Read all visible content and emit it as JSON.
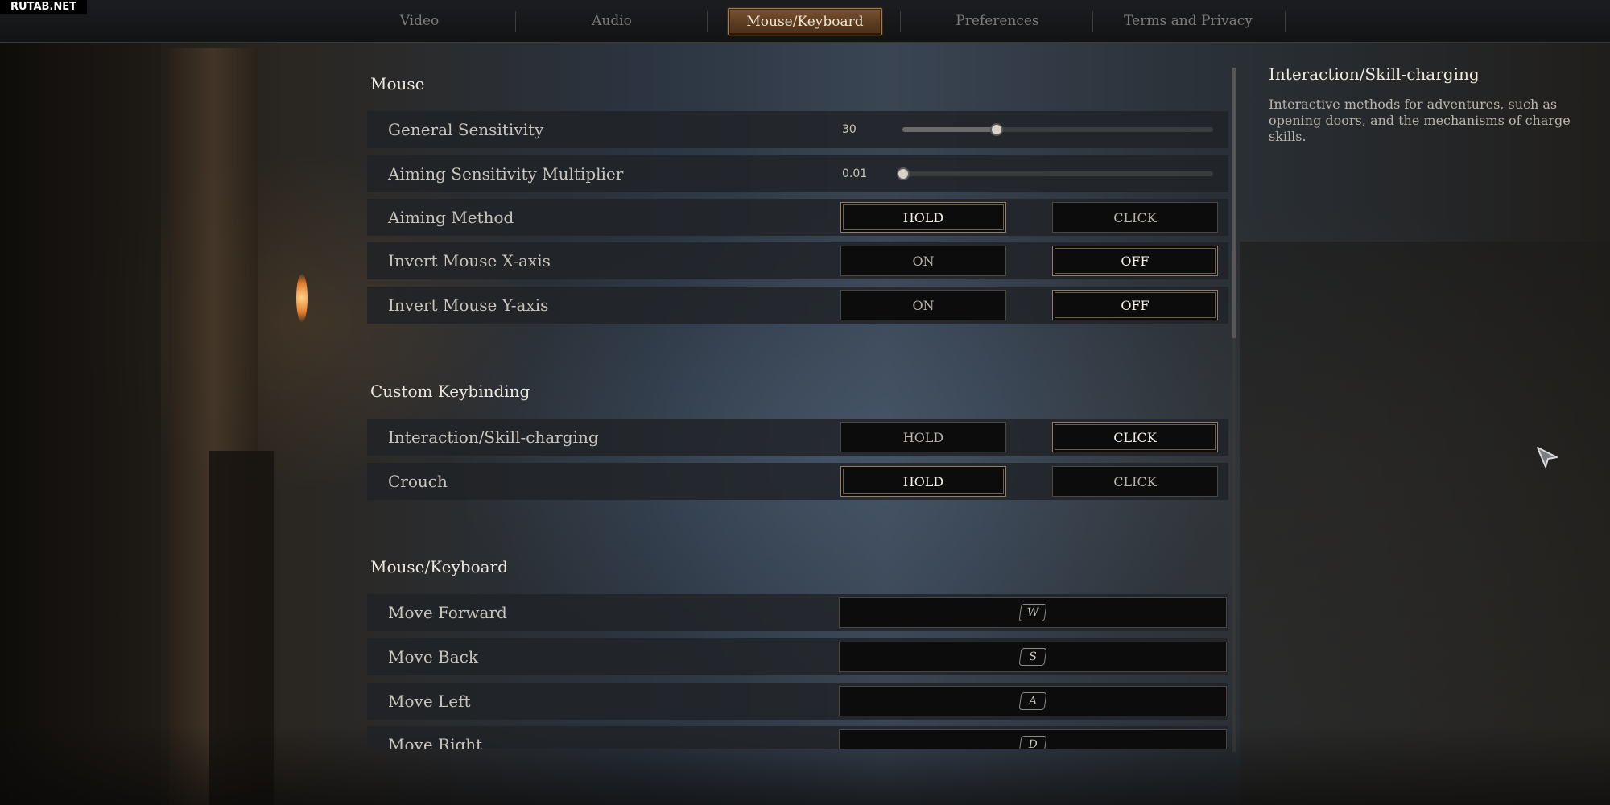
{
  "watermark": "RUTAB.NET",
  "tabs": [
    {
      "label": "Video",
      "active": false
    },
    {
      "label": "Audio",
      "active": false
    },
    {
      "label": "Mouse/Keyboard",
      "active": true
    },
    {
      "label": "Preferences",
      "active": false
    },
    {
      "label": "Terms and Privacy",
      "active": false
    }
  ],
  "sections": {
    "mouse": {
      "title": "Mouse",
      "general_sensitivity": {
        "label": "General Sensitivity",
        "value": "30",
        "level": 0.3
      },
      "aiming_multiplier": {
        "label": "Aiming Sensitivity Multiplier",
        "value": "0.01",
        "level": 0.0
      },
      "aiming_method": {
        "label": "Aiming Method",
        "option_a": "HOLD",
        "option_b": "CLICK",
        "selected": "HOLD"
      },
      "invert_x": {
        "label": "Invert Mouse X-axis",
        "option_a": "ON",
        "option_b": "OFF",
        "selected": "OFF"
      },
      "invert_y": {
        "label": "Invert Mouse Y-axis",
        "option_a": "ON",
        "option_b": "OFF",
        "selected": "OFF"
      }
    },
    "custom": {
      "title": "Custom Keybinding",
      "interaction": {
        "label": "Interaction/Skill-charging",
        "option_a": "HOLD",
        "option_b": "CLICK",
        "selected": "CLICK"
      },
      "crouch": {
        "label": "Crouch",
        "option_a": "HOLD",
        "option_b": "CLICK",
        "selected": "HOLD"
      }
    },
    "keyboard": {
      "title": "Mouse/Keyboard",
      "move_forward": {
        "label": "Move Forward",
        "key": "W"
      },
      "move_back": {
        "label": "Move Back",
        "key": "S"
      },
      "move_left": {
        "label": "Move Left",
        "key": "A"
      },
      "move_right": {
        "label": "Move Right",
        "key": "D"
      }
    }
  },
  "info": {
    "title": "Interaction/Skill-charging",
    "description": "Interactive methods for adventures, such as opening doors, and the mechanisms of charge skills."
  },
  "colors": {
    "accent": "#7a5330",
    "selected_border": "#8f7f6a"
  },
  "icons": {
    "cursor": "arrow-cursor-icon"
  }
}
